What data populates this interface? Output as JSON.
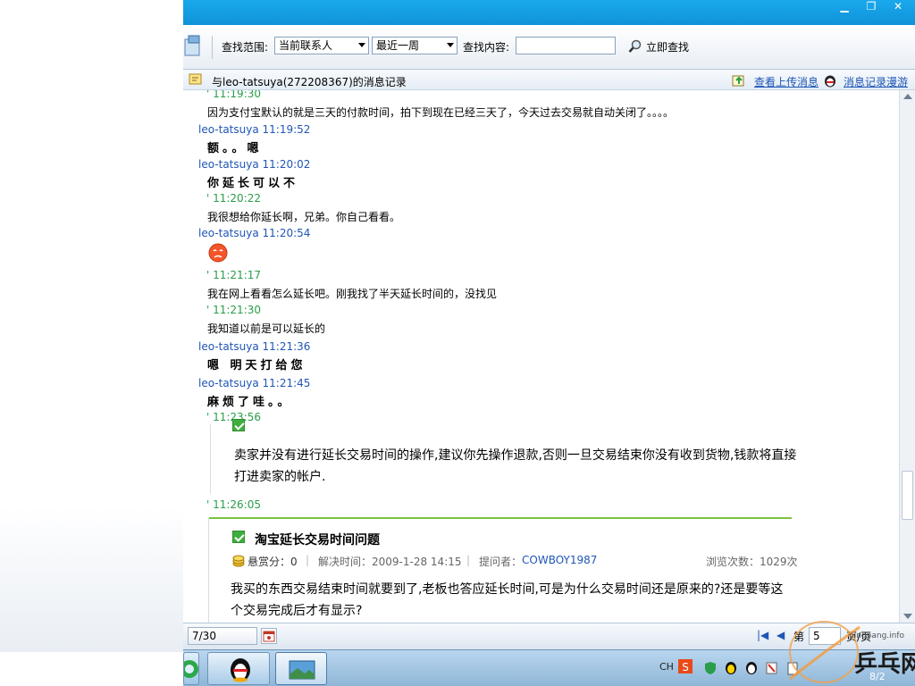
{
  "toolbar": {
    "range_label": "查找范围:",
    "contact_select": "当前联系人",
    "period_select": "最近一周",
    "content_label": "查找内容:",
    "content_value": "",
    "search_button": "立即查找"
  },
  "record_header": {
    "title": "与leo-tatsuya(272208367)的消息记录",
    "view_uploads": "查看上传消息",
    "roaming": "消息记录漫游"
  },
  "messages": [
    {
      "time": "' 11:19:30",
      "text": "因为支付宝默认的就是三天的付款时间，拍下到现在已经三天了，今天过去交易就自动关闭了。。。。"
    },
    {
      "time": "leo-tatsuya 11:19:52",
      "text": "额。。嗯"
    },
    {
      "time": "leo-tatsuya 11:20:02",
      "text": "你延长可以不"
    },
    {
      "time": "' 11:20:22",
      "text": "我很想给你延长啊，兄弟。你自己看看。"
    },
    {
      "time": "leo-tatsuya 11:20:54",
      "text": ""
    },
    {
      "time": "' 11:21:17",
      "text": "我在网上看看怎么延长吧。刚我找了半天延长时间的，没找见"
    },
    {
      "time": "' 11:21:30",
      "text": "我知道以前是可以延长的"
    },
    {
      "time": "leo-tatsuya 11:21:36",
      "text": "嗯 明天打给您"
    },
    {
      "time": "leo-tatsuya 11:21:45",
      "text": "麻烦了哇。。"
    },
    {
      "time": "' 11:23:56",
      "text": ""
    },
    {
      "time": "' 11:26:05",
      "text": ""
    }
  ],
  "card1": {
    "body": "卖家并没有进行延长交易时间的操作,建议你先操作退款,否则一旦交易结束你没有收到货物,钱款将直接打进卖家的帐户."
  },
  "card2": {
    "title": "淘宝延长交易时间问题",
    "reward": "悬赏分：0",
    "solved": "解决时间：2009-1-28 14:15",
    "asker_label": "提问者：",
    "asker": "COWBOY1987",
    "views": "浏览次数：1029次",
    "body": "我买的东西交易结束时间就要到了,老板也答应延长时间,可是为什么交易时间还是原来的?还是要等这个交易完成后才有显示?"
  },
  "pager": {
    "page_field": "7/30",
    "page_prefix": "第",
    "page_value": "5",
    "page_suffix": "页/页"
  },
  "taskbar": {
    "lang": "CH",
    "time": "8/2"
  },
  "watermark": {
    "domain": "pingpang.info",
    "text": "乒乓网"
  },
  "colors": {
    "titlebar": "#1aa9ec",
    "link": "#1f56b5",
    "own_time": "#2a9d4a",
    "card_accent": "#7cc242"
  }
}
